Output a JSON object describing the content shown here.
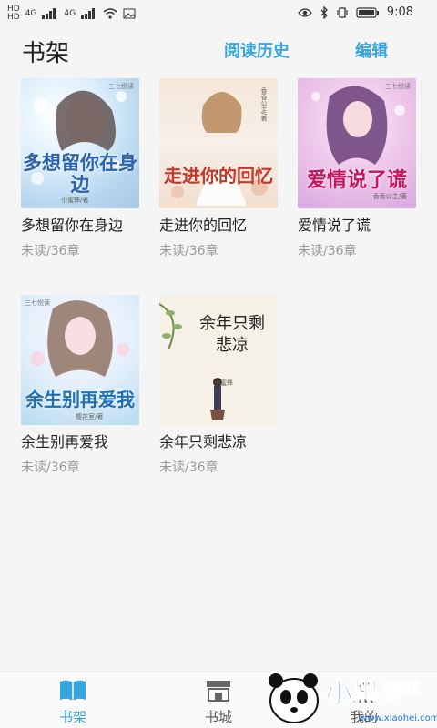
{
  "status_bar": {
    "sim1": "HD",
    "sim2": "HD",
    "network1": "4G",
    "network2": "4G",
    "battery_label": "",
    "time": "9:08"
  },
  "header": {
    "title": "书架",
    "history_label": "阅读历史",
    "edit_label": "编辑"
  },
  "books": [
    {
      "title": "多想留你在身边",
      "progress": "未读/36章",
      "cover_text": "多想留你在身边",
      "cover_author": "小蜜蜂/著"
    },
    {
      "title": "走进你的回忆",
      "progress": "未读/36章",
      "cover_text": "走进你的回忆",
      "cover_author": "香香公主/著"
    },
    {
      "title": "爱情说了谎",
      "progress": "未读/36章",
      "cover_text": "爱情说了谎",
      "cover_author": "香香公主/著"
    },
    {
      "title": "余生别再爱我",
      "progress": "未读/36章",
      "cover_text": "余生别再爱我",
      "cover_author": "樱花室/著"
    },
    {
      "title": "余年只剩悲凉",
      "progress": "未读/36章",
      "cover_text": "余年只剩悲凉",
      "cover_author": "小蜜蜂"
    }
  ],
  "tabs": [
    {
      "label": "书架",
      "icon": "book-open-icon",
      "active": true
    },
    {
      "label": "书城",
      "icon": "store-icon",
      "active": false
    },
    {
      "label": "我的",
      "icon": "profile-icon",
      "active": false
    }
  ],
  "watermark": {
    "text": "小黑游戏",
    "url": "www.xiaohei.com"
  },
  "colors": {
    "accent": "#37a6de",
    "background": "#f5f5f5",
    "progress_text": "#999999"
  }
}
